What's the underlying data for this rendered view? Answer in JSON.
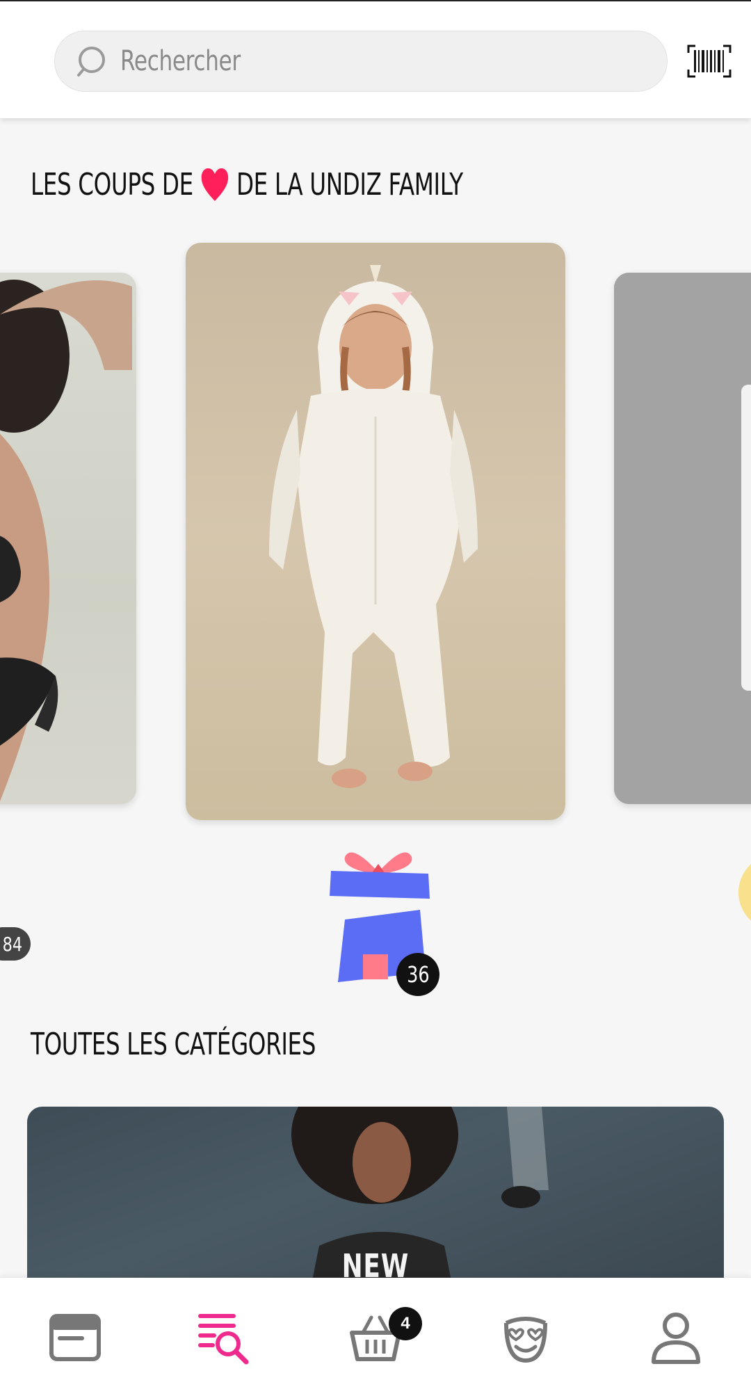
{
  "search": {
    "placeholder": "Rechercher",
    "search_icon": "search-icon",
    "barcode_icon": "barcode-scanner-icon"
  },
  "favorites": {
    "title_before": "LES COUPS DE",
    "title_after": "DE LA UNDIZ FAMILY",
    "heart_color": "#ff1f5a",
    "cards": [
      {
        "position": "left",
        "description_icon": "lingerie-photo"
      },
      {
        "position": "center",
        "description_icon": "unicorn-onesie-photo"
      },
      {
        "position": "right",
        "description_icon": "product-photo"
      }
    ]
  },
  "gift": {
    "icon": "gift-icon",
    "count": "36",
    "side_pill": "84"
  },
  "categories": {
    "title": "TOUTES LES CATÉGORIES",
    "banner_label": "NEW"
  },
  "bottom_nav": {
    "items": [
      {
        "name": "home",
        "icon": "browser-window-icon",
        "active": false
      },
      {
        "name": "search",
        "icon": "list-search-icon",
        "active": true
      },
      {
        "name": "cart",
        "icon": "basket-icon",
        "active": false,
        "badge": "4"
      },
      {
        "name": "favorites",
        "icon": "heart-eyes-face-icon",
        "active": false
      },
      {
        "name": "account",
        "icon": "user-icon",
        "active": false
      }
    ],
    "active_color": "#ee2a8c",
    "inactive_color": "#777777"
  }
}
